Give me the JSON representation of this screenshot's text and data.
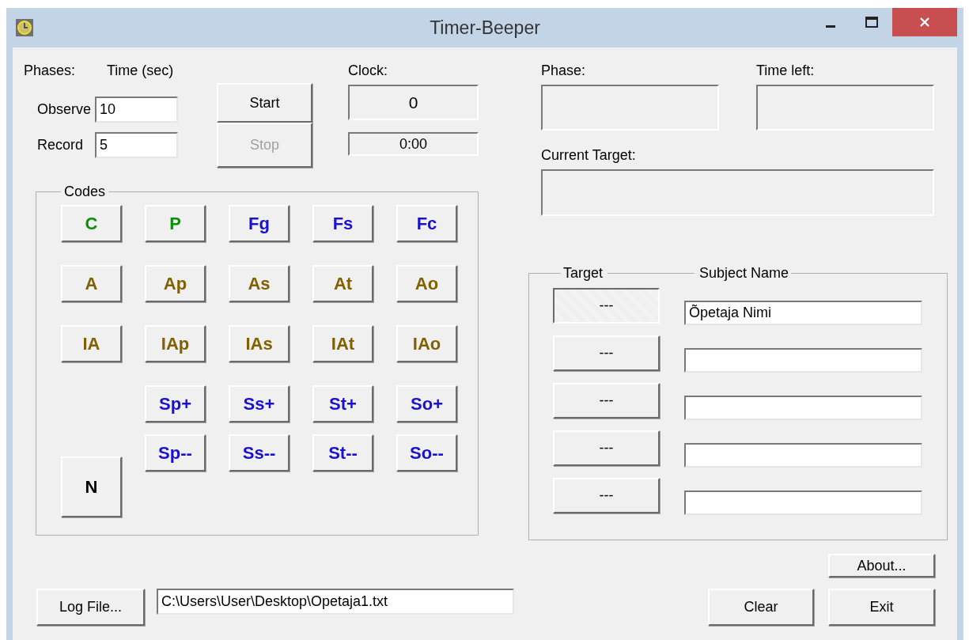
{
  "window": {
    "title": "Timer-Beeper"
  },
  "phases": {
    "label": "Phases:",
    "time_label": "Time (sec)",
    "rows": [
      {
        "label": "Observe",
        "value": "10"
      },
      {
        "label": "Record",
        "value": "5"
      }
    ]
  },
  "start_button": {
    "label": "Start",
    "disabled": false
  },
  "stop_button": {
    "label": "Stop",
    "disabled": true
  },
  "clock": {
    "label": "Clock:",
    "count": "0",
    "time": "0:00"
  },
  "phase": {
    "label": "Phase:"
  },
  "time_left": {
    "label": "Time left:"
  },
  "current_target": {
    "label": "Current Target:"
  },
  "codes": {
    "title": "Codes",
    "grid": [
      [
        {
          "label": "C",
          "color": "#0a900a"
        },
        {
          "label": "P",
          "color": "#0a900a"
        },
        {
          "label": "Fg",
          "color": "#1a10d0"
        },
        {
          "label": "Fs",
          "color": "#1a10d0"
        },
        {
          "label": "Fc",
          "color": "#1a10d0"
        }
      ],
      [
        {
          "label": "A",
          "color": "#806000"
        },
        {
          "label": "Ap",
          "color": "#806000"
        },
        {
          "label": "As",
          "color": "#806000"
        },
        {
          "label": "At",
          "color": "#806000"
        },
        {
          "label": "Ao",
          "color": "#806000"
        }
      ],
      [
        {
          "label": "IA",
          "color": "#806000"
        },
        {
          "label": "IAp",
          "color": "#806000"
        },
        {
          "label": "IAs",
          "color": "#806000"
        },
        {
          "label": "IAt",
          "color": "#806000"
        },
        {
          "label": "IAo",
          "color": "#806000"
        }
      ]
    ],
    "shift_rows": [
      [
        {
          "label": "Sp+",
          "color": "#1a10d0"
        },
        {
          "label": "Ss+",
          "color": "#1a10d0"
        },
        {
          "label": "St+",
          "color": "#1a10d0"
        },
        {
          "label": "So+",
          "color": "#1a10d0"
        }
      ],
      [
        {
          "label": "Sp--",
          "color": "#1a10d0"
        },
        {
          "label": "Ss--",
          "color": "#1a10d0"
        },
        {
          "label": "St--",
          "color": "#1a10d0"
        },
        {
          "label": "So--",
          "color": "#1a10d0"
        }
      ]
    ],
    "n_button": {
      "label": "N",
      "color": "#000000"
    }
  },
  "targets": {
    "target_title": "Target",
    "name_title": "Subject Name",
    "rows": [
      {
        "button": "---",
        "selected": true,
        "name": "Õpetaja Nimi"
      },
      {
        "button": "---",
        "selected": false
      },
      {
        "button": "---",
        "selected": false
      },
      {
        "button": "---",
        "selected": false
      },
      {
        "button": "---",
        "selected": false
      }
    ]
  },
  "about_button": "About...",
  "log_file": {
    "button": "Log File...",
    "path": "C:\\Users\\User\\Desktop\\Opetaja1.txt"
  },
  "clear_button": "Clear",
  "exit_button": "Exit"
}
